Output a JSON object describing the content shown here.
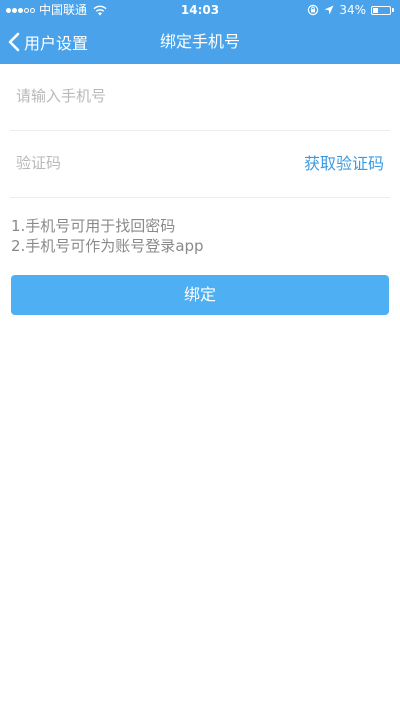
{
  "status_bar": {
    "carrier": "中国联通",
    "time": "14:03",
    "battery_percent": "34%",
    "battery_level": 0.34,
    "signal_strength": 3,
    "signal_max": 5
  },
  "nav": {
    "back_label": "用户设置",
    "title": "绑定手机号"
  },
  "form": {
    "phone_placeholder": "请输入手机号",
    "phone_value": "",
    "code_placeholder": "验证码",
    "code_value": "",
    "get_code_label": "获取验证码"
  },
  "tips": [
    "1.手机号可用于找回密码",
    "2.手机号可作为账号登录app"
  ],
  "bind_button_label": "绑定",
  "colors": {
    "header": "#4aa3ea",
    "accent_text": "#3c9be0",
    "button": "#4eb0f3"
  },
  "icons": {
    "back": "chevron-left-icon",
    "wifi": "wifi-icon",
    "orientation_lock": "orientation-lock-icon",
    "location": "location-arrow-icon",
    "battery": "battery-icon"
  }
}
